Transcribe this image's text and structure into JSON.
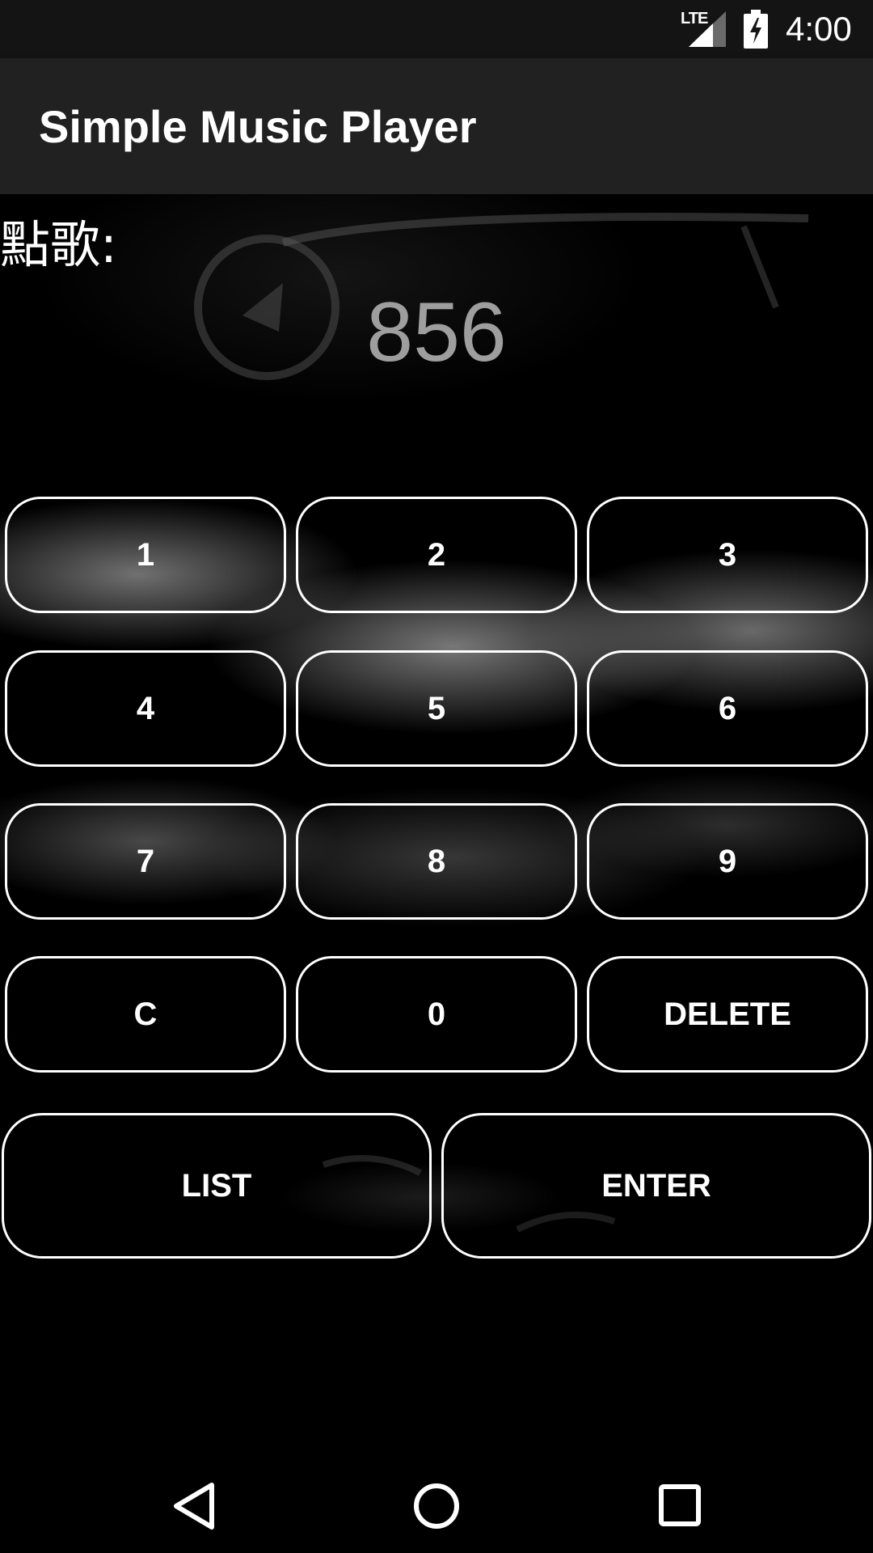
{
  "status_bar": {
    "network": "LTE",
    "time": "4:00",
    "signal_icon": "signal-icon",
    "battery_icon": "battery-charging-icon"
  },
  "app_bar": {
    "title": "Simple Music Player"
  },
  "main": {
    "song_label": "點歌:",
    "number_display": "856",
    "keypad": {
      "rows": [
        [
          "1",
          "2",
          "3"
        ],
        [
          "4",
          "5",
          "6"
        ],
        [
          "7",
          "8",
          "9"
        ],
        [
          "C",
          "0",
          "DELETE"
        ]
      ]
    },
    "actions": {
      "list_label": "LIST",
      "enter_label": "ENTER"
    }
  },
  "nav_bar": {
    "back_icon": "back-icon",
    "home_icon": "home-icon",
    "recents_icon": "recents-icon"
  },
  "colors": {
    "status_bar_bg": "#141414",
    "app_bar_bg": "#212121",
    "number_display": "#9e9e9e",
    "button_border": "#ffffff"
  }
}
